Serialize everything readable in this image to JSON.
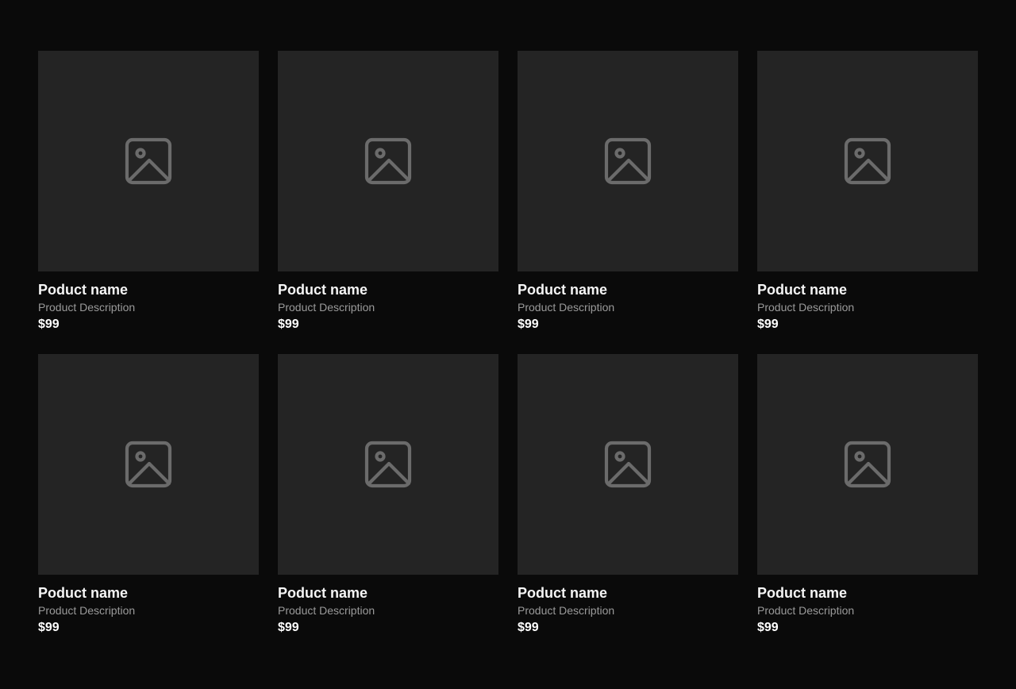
{
  "theme": {
    "background": "#0a0a0a",
    "placeholder_bg": "#242424",
    "icon_color": "#6b6b6b",
    "title_color": "#f5f5f5",
    "description_color": "#9a9a9a"
  },
  "products": [
    {
      "name": "Poduct name",
      "description": "Product Description",
      "price": "$99",
      "image_icon": "image-placeholder-icon"
    },
    {
      "name": "Poduct name",
      "description": "Product Description",
      "price": "$99",
      "image_icon": "image-placeholder-icon"
    },
    {
      "name": "Poduct name",
      "description": "Product Description",
      "price": "$99",
      "image_icon": "image-placeholder-icon"
    },
    {
      "name": "Poduct name",
      "description": "Product Description",
      "price": "$99",
      "image_icon": "image-placeholder-icon"
    },
    {
      "name": "Poduct name",
      "description": "Product Description",
      "price": "$99",
      "image_icon": "image-placeholder-icon"
    },
    {
      "name": "Poduct name",
      "description": "Product Description",
      "price": "$99",
      "image_icon": "image-placeholder-icon"
    },
    {
      "name": "Poduct name",
      "description": "Product Description",
      "price": "$99",
      "image_icon": "image-placeholder-icon"
    },
    {
      "name": "Poduct name",
      "description": "Product Description",
      "price": "$99",
      "image_icon": "image-placeholder-icon"
    }
  ]
}
